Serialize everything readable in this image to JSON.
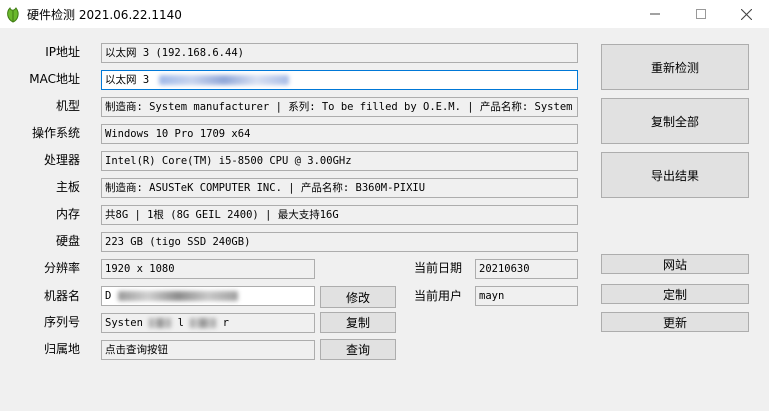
{
  "window": {
    "title": "硬件检测 2021.06.22.1140"
  },
  "labels": {
    "ip": "IP地址",
    "mac": "MAC地址",
    "model": "机型",
    "os": "操作系统",
    "cpu": "处理器",
    "board": "主板",
    "memory": "内存",
    "disk": "硬盘",
    "resolution": "分辨率",
    "hostname": "机器名",
    "serial": "序列号",
    "location": "归属地",
    "date": "当前日期",
    "user": "当前用户"
  },
  "fields": {
    "ip": "以太网 3 (192.168.6.44)",
    "mac_prefix": "以太网 3",
    "model": "制造商: System manufacturer | 系列: To be filled by O.E.M. | 产品名称: System Product Name",
    "os": "Windows 10 Pro 1709 x64",
    "cpu": "Intel(R) Core(TM) i5-8500 CPU @ 3.00GHz",
    "board": "制造商: ASUSTeK COMPUTER INC. | 产品名称: B360M-PIXIU",
    "memory": "共8G | 1根 (8G GEIL 2400) | 最大支持16G",
    "disk": "223 GB (tigo SSD 240GB)",
    "resolution": "1920 x 1080",
    "hostname_prefix": "D",
    "serial_prefix": "Systen",
    "serial_mid": "l",
    "serial_suffix": "r",
    "location": "点击查询按钮",
    "date": "20210630",
    "user": "mayn"
  },
  "buttons": {
    "redetect": "重新检测",
    "copy_all": "复制全部",
    "export": "导出结果",
    "website": "网站",
    "customize": "定制",
    "update": "更新",
    "modify": "修改",
    "copy": "复制",
    "query": "查询"
  }
}
